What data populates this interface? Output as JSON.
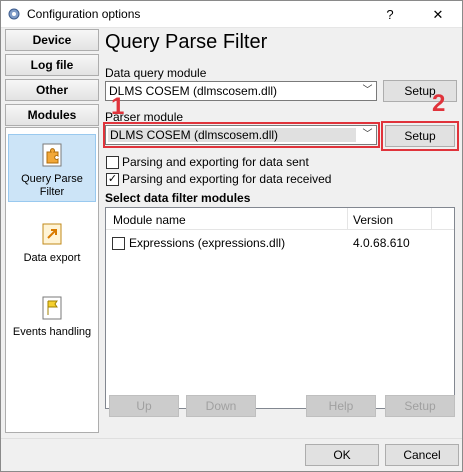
{
  "window": {
    "title": "Configuration options",
    "help_symbol": "?",
    "close_symbol": "✕"
  },
  "sidebar": {
    "buttons": [
      {
        "label": "Device"
      },
      {
        "label": "Log file"
      },
      {
        "label": "Other"
      },
      {
        "label": "Modules"
      }
    ],
    "items": [
      {
        "label": "Query Parse Filter",
        "icon": "puzzle-icon",
        "selected": true
      },
      {
        "label": "Data export",
        "icon": "export-icon",
        "selected": false
      },
      {
        "label": "Events handling",
        "icon": "flag-icon",
        "selected": false
      }
    ]
  },
  "main": {
    "heading": "Query Parse Filter",
    "data_query": {
      "label": "Data query module",
      "value": "DLMS COSEM (dlmscosem.dll)",
      "setup_label": "Setup"
    },
    "parser": {
      "label": "Parser module",
      "value": "DLMS COSEM (dlmscosem.dll)",
      "setup_label": "Setup"
    },
    "options": [
      {
        "label": "Parsing and exporting for data sent",
        "checked": false
      },
      {
        "label": "Parsing and exporting for data received",
        "checked": true
      }
    ],
    "filters": {
      "section_label": "Select data filter modules",
      "columns": [
        "Module name",
        "Version"
      ],
      "rows": [
        {
          "name": "Expressions (expressions.dll)",
          "version": "4.0.68.610",
          "checked": false
        }
      ]
    },
    "list_buttons": {
      "up": "Up",
      "down": "Down",
      "help": "Help",
      "setup": "Setup"
    },
    "annotations": {
      "marker_1": "1",
      "marker_2": "2",
      "color": "#e0333b"
    }
  },
  "footer": {
    "ok": "OK",
    "cancel": "Cancel"
  }
}
